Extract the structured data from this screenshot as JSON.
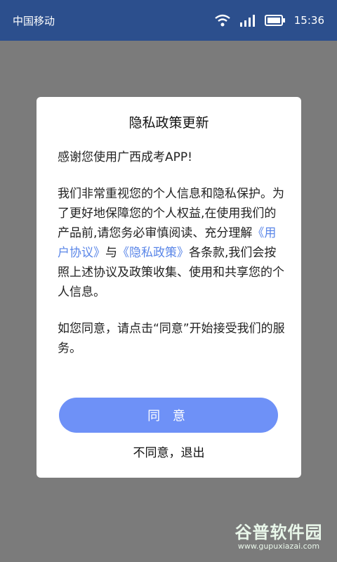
{
  "status_bar": {
    "carrier": "中国移动",
    "time": "15:36",
    "icons": [
      "wifi-icon",
      "signal-icon",
      "battery-icon"
    ]
  },
  "dialog": {
    "title": "隐私政策更新",
    "p1": "感谢您使用广西成考APP!",
    "p2_prefix": "我们非常重视您的个人信息和隐私保护。为了更好地保障您的个人权益,在使用我们的产品前,请您务必审慎阅读、充分理解",
    "link_user_agreement": "《用户协议》",
    "p2_middle": "与",
    "link_privacy_policy": "《隐私政策》",
    "p2_suffix": "各条款,我们会按照上述协议及政策收集、使用和共享您的个人信息。",
    "p3": "如您同意，请点击“同意”开始接受我们的服务。",
    "agree_button": "同 意",
    "disagree_button": "不同意，退出"
  },
  "watermark": {
    "logo_text": "谷普软件园",
    "url": "www.gupuxiazai.com"
  },
  "colors": {
    "status_bar": "#2c4f8d",
    "backdrop": "#7b7b7b",
    "link": "#5a86e8",
    "button": "#6e91f7"
  }
}
